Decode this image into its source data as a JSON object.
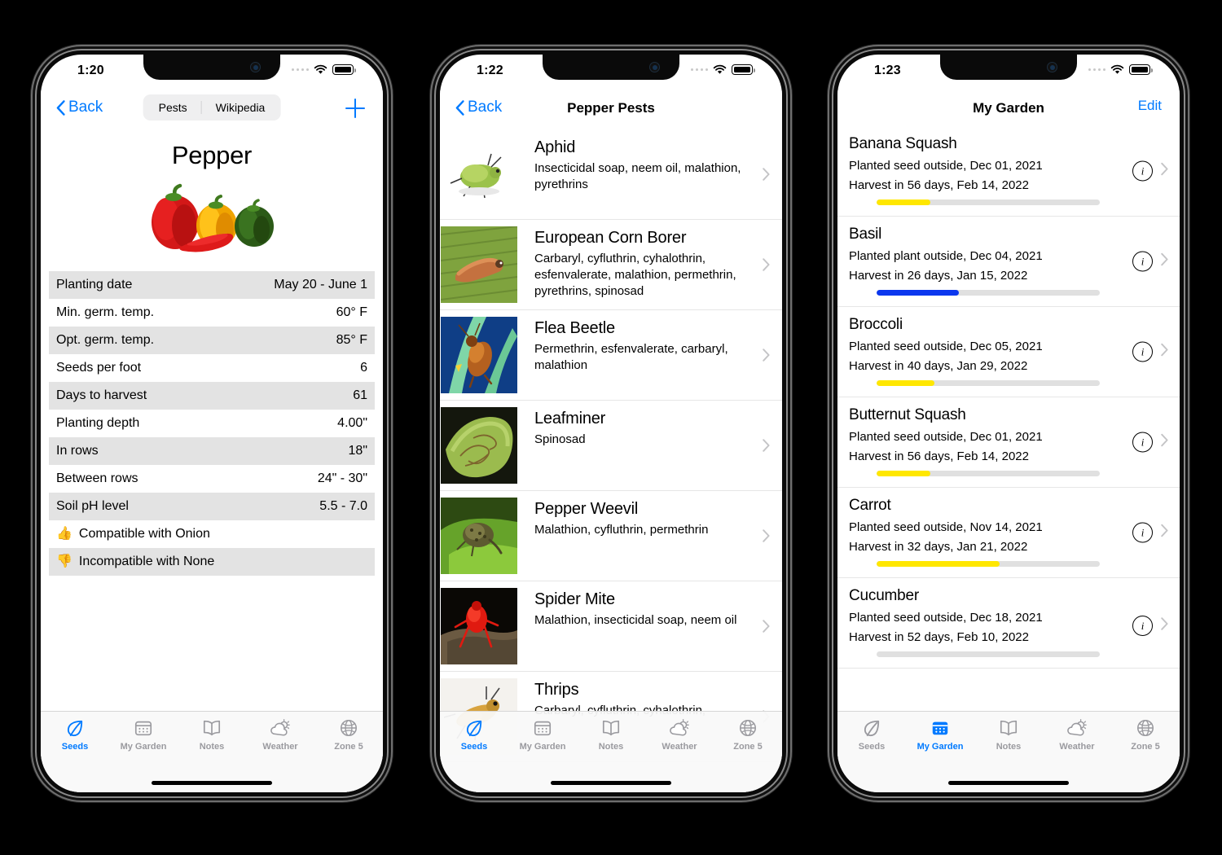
{
  "app": {
    "accent": "#007aff",
    "inactive_tab_color": "#9a9a9f",
    "row_alt_bg": "#e3e3e3"
  },
  "tabs": [
    {
      "label": "Seeds",
      "icon": "leaf-icon"
    },
    {
      "label": "My Garden",
      "icon": "calendar-icon"
    },
    {
      "label": "Notes",
      "icon": "book-icon"
    },
    {
      "label": "Weather",
      "icon": "cloud-sun-icon"
    },
    {
      "label": "Zone 5",
      "icon": "globe-icon"
    }
  ],
  "phone1": {
    "status": {
      "time": "1:20"
    },
    "nav": {
      "back_label": "Back",
      "add_label": "+"
    },
    "segmented": {
      "options": [
        "Pests",
        "Wikipedia"
      ],
      "selected": "Pests"
    },
    "title": "Pepper",
    "image": "pepper-photo",
    "table": [
      {
        "key": "Planting date",
        "value": "May 20 - June 1"
      },
      {
        "key": "Min. germ. temp.",
        "value": "60° F"
      },
      {
        "key": "Opt. germ. temp.",
        "value": "85° F"
      },
      {
        "key": "Seeds per foot",
        "value": "6"
      },
      {
        "key": "Days to harvest",
        "value": "61"
      },
      {
        "key": "Planting depth",
        "value": "4.00\""
      },
      {
        "key": "In rows",
        "value": "18\""
      },
      {
        "key": "Between rows",
        "value": "24\" - 30\""
      },
      {
        "key": "Soil pH level",
        "value": "5.5 - 7.0"
      }
    ],
    "compatible": {
      "emoji": "👍",
      "text": "Compatible with Onion"
    },
    "incompatible": {
      "emoji": "👎",
      "text": "Incompatible with None"
    },
    "active_tab": "Seeds"
  },
  "phone2": {
    "status": {
      "time": "1:22"
    },
    "nav": {
      "back_label": "Back",
      "title": "Pepper Pests"
    },
    "pests": [
      {
        "name": "Aphid",
        "treatments": "Insecticidal soap, neem oil, malathion, pyrethrins",
        "image": "aphid-photo"
      },
      {
        "name": "European Corn Borer",
        "treatments": "Carbaryl, cyfluthrin, cyhalothrin, esfenvalerate, malathion, permethrin, pyrethrins, spinosad",
        "image": "corn-borer-photo"
      },
      {
        "name": "Flea Beetle",
        "treatments": "Permethrin, esfenvalerate, carbaryl, malathion",
        "image": "flea-beetle-photo"
      },
      {
        "name": "Leafminer",
        "treatments": "Spinosad",
        "image": "leafminer-photo"
      },
      {
        "name": "Pepper Weevil",
        "treatments": "Malathion, cyfluthrin, permethrin",
        "image": "pepper-weevil-photo"
      },
      {
        "name": "Spider Mite",
        "treatments": "Malathion, insecticidal soap, neem oil",
        "image": "spider-mite-photo"
      },
      {
        "name": "Thrips",
        "treatments": "Carbaryl, cyfluthrin, cyhalothrin,",
        "image": "thrips-photo"
      }
    ],
    "active_tab": "Seeds"
  },
  "phone3": {
    "status": {
      "time": "1:23"
    },
    "nav": {
      "title": "My Garden",
      "edit_label": "Edit"
    },
    "plants": [
      {
        "name": "Banana Squash",
        "planted": "Planted seed outside, Dec 01, 2021",
        "harvest": "Harvest in 56 days, Feb 14, 2022",
        "progress": 24,
        "progress_color": "#ffe700"
      },
      {
        "name": "Basil",
        "planted": "Planted plant outside, Dec 04, 2021",
        "harvest": "Harvest in 26 days, Jan 15, 2022",
        "progress": 37,
        "progress_color": "#0b37ee"
      },
      {
        "name": "Broccoli",
        "planted": "Planted seed outside, Dec 05, 2021",
        "harvest": "Harvest in 40 days, Jan 29, 2022",
        "progress": 26,
        "progress_color": "#ffe700"
      },
      {
        "name": "Butternut Squash",
        "planted": "Planted seed outside, Dec 01, 2021",
        "harvest": "Harvest in 56 days, Feb 14, 2022",
        "progress": 24,
        "progress_color": "#ffe700"
      },
      {
        "name": "Carrot",
        "planted": "Planted seed outside, Nov 14, 2021",
        "harvest": "Harvest in 32 days, Jan 21, 2022",
        "progress": 55,
        "progress_color": "#ffe700"
      },
      {
        "name": "Cucumber",
        "planted": "Planted seed outside, Dec 18, 2021",
        "harvest": "Harvest in 52 days, Feb 10, 2022",
        "progress": 0,
        "progress_color": "#ffe700"
      }
    ],
    "active_tab": "My Garden"
  }
}
